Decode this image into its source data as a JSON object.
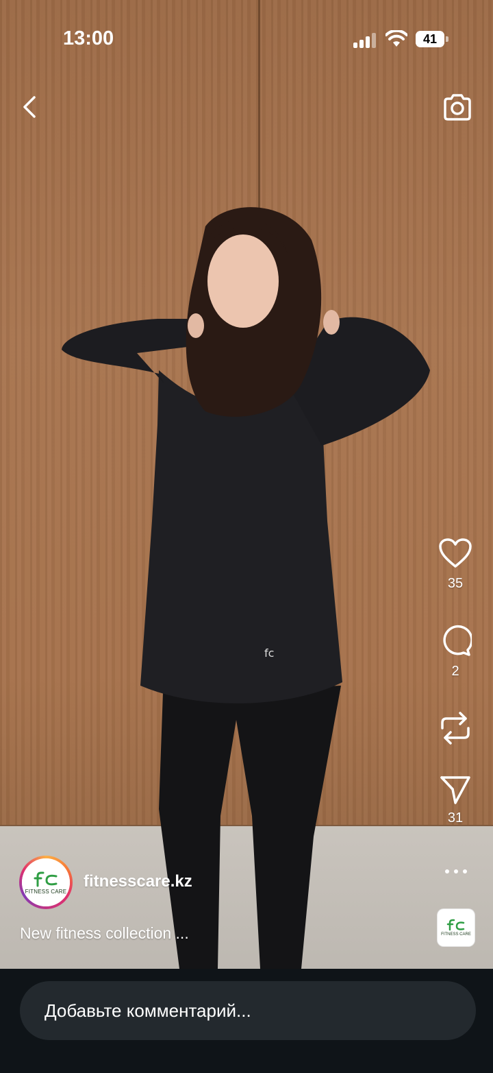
{
  "status_bar": {
    "time": "13:00",
    "battery": "41"
  },
  "actions": {
    "likes": "35",
    "comments": "2",
    "shares": "31"
  },
  "post": {
    "username": "fitnesscare.kz",
    "caption": "New fitness collection ...",
    "brand_logo_text": "FITNESS CARE"
  },
  "comment_bar": {
    "placeholder": "Добавьте комментарий..."
  },
  "icons": [
    "back-arrow-icon",
    "camera-icon",
    "heart-icon",
    "comment-icon",
    "repost-icon",
    "send-icon",
    "more-icon",
    "signal-icon",
    "wifi-icon",
    "battery-icon"
  ],
  "colors": {
    "bottom_bar": "#0f1418",
    "input_bg": "#23292e",
    "brand_green": "#2f9e44"
  }
}
